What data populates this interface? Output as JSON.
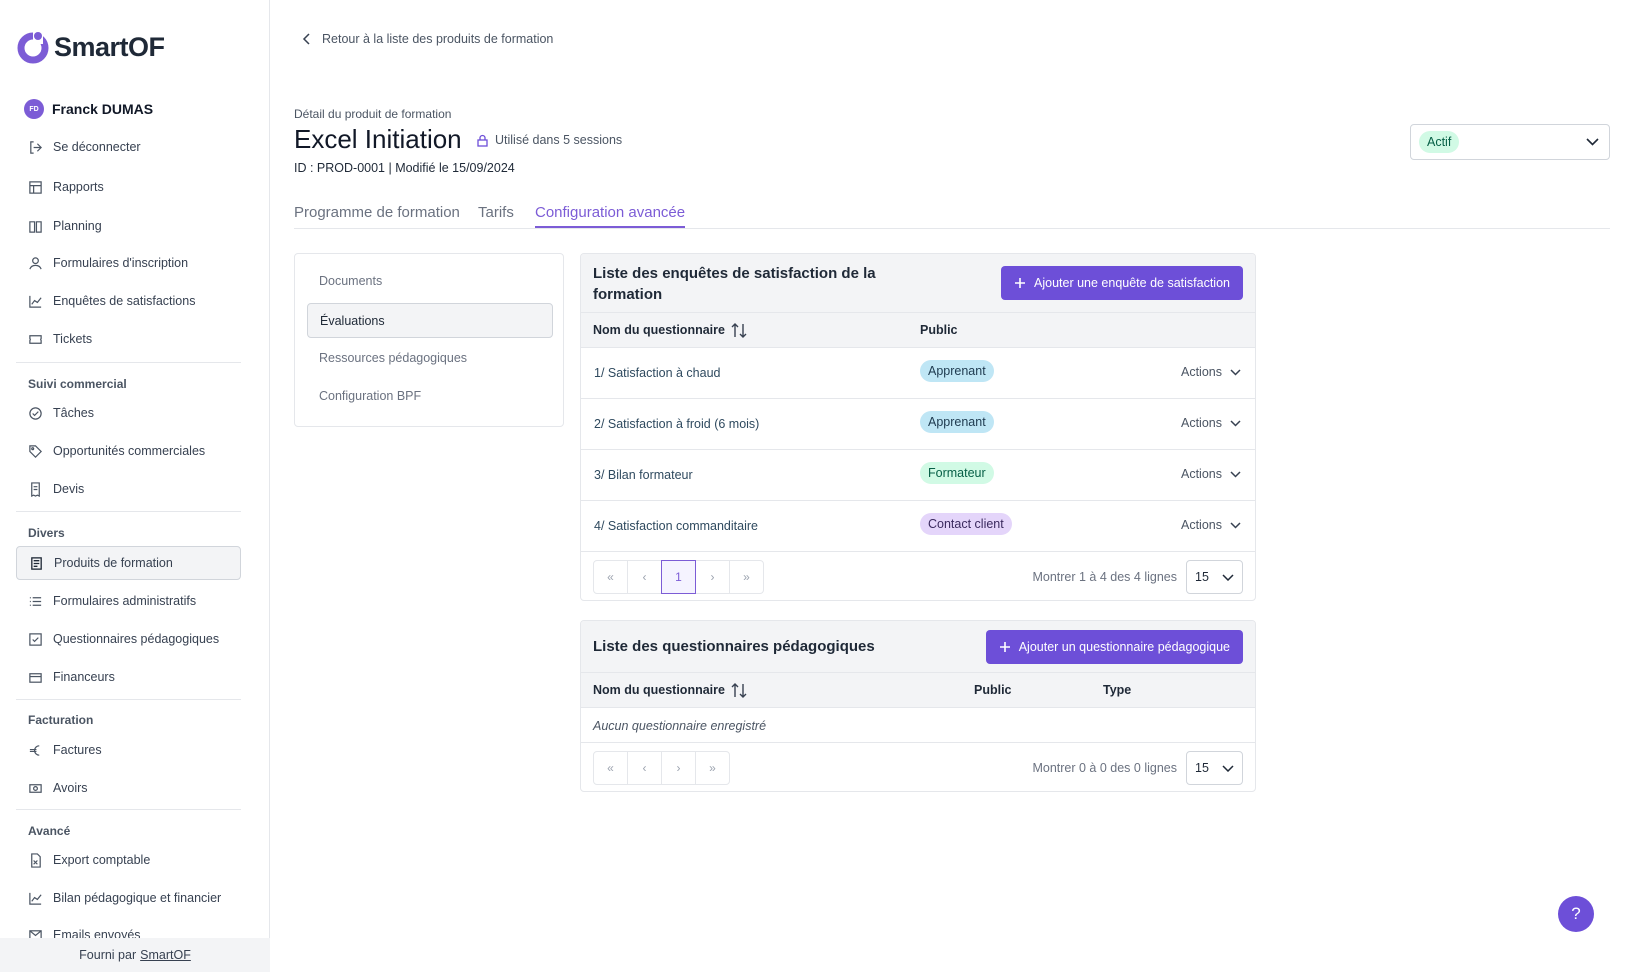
{
  "brand": {
    "name": "SmartOF",
    "accent": "#6d4fd8"
  },
  "user": {
    "initials": "FD",
    "name": "Franck DUMAS",
    "logout": "Se déconnecter"
  },
  "sidebar": {
    "items": [
      {
        "label": "Rapports",
        "icon": "table-icon"
      },
      {
        "label": "Planning",
        "icon": "book-icon"
      },
      {
        "label": "Formulaires d'inscription",
        "icon": "user-icon"
      },
      {
        "label": "Enquêtes de satisfactions",
        "icon": "chart-icon"
      },
      {
        "label": "Tickets",
        "icon": "ticket-icon"
      }
    ],
    "sections": {
      "commercial": {
        "title": "Suivi commercial",
        "items": [
          {
            "label": "Tâches",
            "icon": "check-circle-icon"
          },
          {
            "label": "Opportunités commerciales",
            "icon": "tag-icon"
          },
          {
            "label": "Devis",
            "icon": "receipt-icon"
          }
        ]
      },
      "divers": {
        "title": "Divers",
        "items": [
          {
            "label": "Produits de formation",
            "icon": "document-icon"
          },
          {
            "label": "Formulaires administratifs",
            "icon": "list-icon"
          },
          {
            "label": "Questionnaires pédagogiques",
            "icon": "checkbox-icon"
          },
          {
            "label": "Financeurs",
            "icon": "card-icon"
          }
        ]
      },
      "facturation": {
        "title": "Facturation",
        "items": [
          {
            "label": "Factures",
            "icon": "euro-icon"
          },
          {
            "label": "Avoirs",
            "icon": "banknote-icon"
          }
        ]
      },
      "avance": {
        "title": "Avancé",
        "items": [
          {
            "label": "Export comptable",
            "icon": "file-x-icon"
          },
          {
            "label": "Bilan pédagogique et financier",
            "icon": "chart-icon"
          },
          {
            "label": "Emails envoyés",
            "icon": "mail-icon"
          }
        ]
      }
    },
    "footer": {
      "prefix": "Fourni par",
      "link": "SmartOF"
    }
  },
  "header": {
    "back": "Retour à la liste des produits de formation",
    "subtitle": "Détail du produit de formation",
    "title": "Excel Initiation",
    "used_in": "Utilisé dans 5 sessions",
    "meta": "ID : PROD-0001 | Modifié le 15/09/2024",
    "status": "Actif"
  },
  "tabs": [
    "Programme de formation",
    "Tarifs",
    "Configuration avancée"
  ],
  "subnav": [
    "Documents",
    "Évaluations",
    "Ressources pédagogiques",
    "Configuration BPF"
  ],
  "surveys": {
    "title": "Liste des enquêtes de satisfaction de la formation",
    "add_button": "Ajouter une enquête de satisfaction",
    "columns": [
      "Nom du questionnaire",
      "Public"
    ],
    "rows": [
      {
        "name": "1/ Satisfaction à chaud",
        "public": "Apprenant",
        "actions": "Actions"
      },
      {
        "name": "2/ Satisfaction à froid (6 mois)",
        "public": "Apprenant",
        "actions": "Actions"
      },
      {
        "name": "3/ Bilan formateur",
        "public": "Formateur",
        "actions": "Actions"
      },
      {
        "name": "4/ Satisfaction commanditaire",
        "public": "Contact client",
        "actions": "Actions"
      }
    ],
    "current_page": "1",
    "info": "Montrer 1 à 4 des 4 lignes",
    "page_size": "15"
  },
  "questionnaires": {
    "title": "Liste des questionnaires pédagogiques",
    "add_button": "Ajouter un questionnaire pédagogique",
    "columns": [
      "Nom du questionnaire",
      "Public",
      "Type"
    ],
    "empty": "Aucun questionnaire enregistré",
    "info": "Montrer 0 à 0 des 0 lignes",
    "page_size": "15"
  },
  "help": "?"
}
